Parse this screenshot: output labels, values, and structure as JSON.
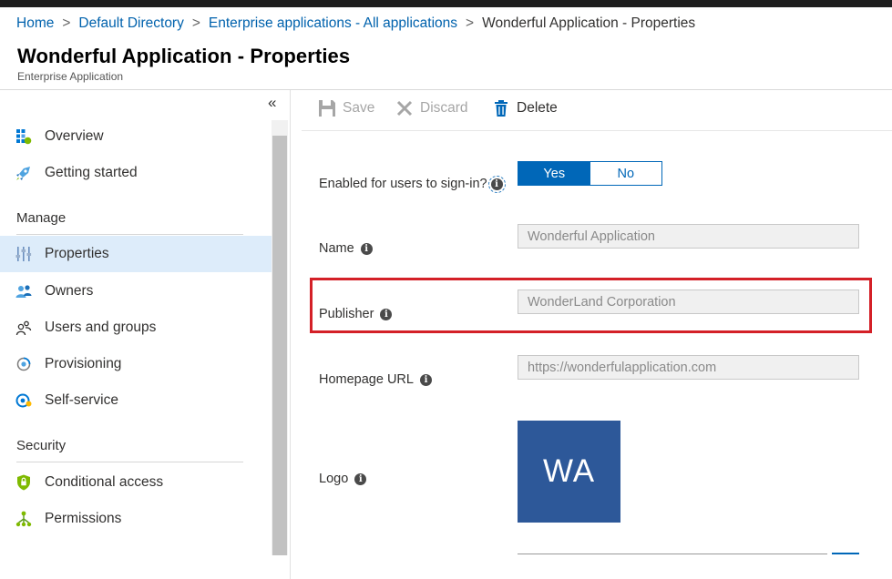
{
  "breadcrumb": {
    "items": [
      "Home",
      "Default Directory",
      "Enterprise applications - All applications"
    ],
    "current": "Wonderful Application - Properties",
    "separator": ">"
  },
  "header": {
    "title": "Wonderful Application - Properties",
    "subtitle": "Enterprise Application"
  },
  "sidebar": {
    "collapse_glyph": "«",
    "items_top": [
      {
        "label": "Overview",
        "icon": "overview-grid-icon"
      },
      {
        "label": "Getting started",
        "icon": "rocket-icon"
      }
    ],
    "manage_label": "Manage",
    "manage_items": [
      {
        "label": "Properties",
        "icon": "properties-sliders-icon",
        "active": true
      },
      {
        "label": "Owners",
        "icon": "owners-icon"
      },
      {
        "label": "Users and groups",
        "icon": "users-groups-icon"
      },
      {
        "label": "Provisioning",
        "icon": "provisioning-icon"
      },
      {
        "label": "Self-service",
        "icon": "self-service-icon"
      }
    ],
    "security_label": "Security",
    "security_items": [
      {
        "label": "Conditional access",
        "icon": "shield-icon"
      },
      {
        "label": "Permissions",
        "icon": "permissions-tree-icon"
      }
    ]
  },
  "toolbar": {
    "save_label": "Save",
    "discard_label": "Discard",
    "delete_label": "Delete"
  },
  "form": {
    "enabled_label": "Enabled for users to sign-in?",
    "toggle_yes": "Yes",
    "toggle_no": "No",
    "toggle_selected": "Yes",
    "name_label": "Name",
    "name_value": "Wonderful Application",
    "publisher_label": "Publisher",
    "publisher_value": "WonderLand Corporation",
    "homepage_label": "Homepage URL",
    "homepage_value": "https://wonderfulapplication.com",
    "logo_label": "Logo",
    "logo_text": "WA",
    "info_glyph": "i"
  },
  "colors": {
    "accent": "#0067b8",
    "link": "#0062ad",
    "active_nav": "#ddecfa",
    "highlight": "#d42027",
    "logo_bg": "#2d5899"
  }
}
